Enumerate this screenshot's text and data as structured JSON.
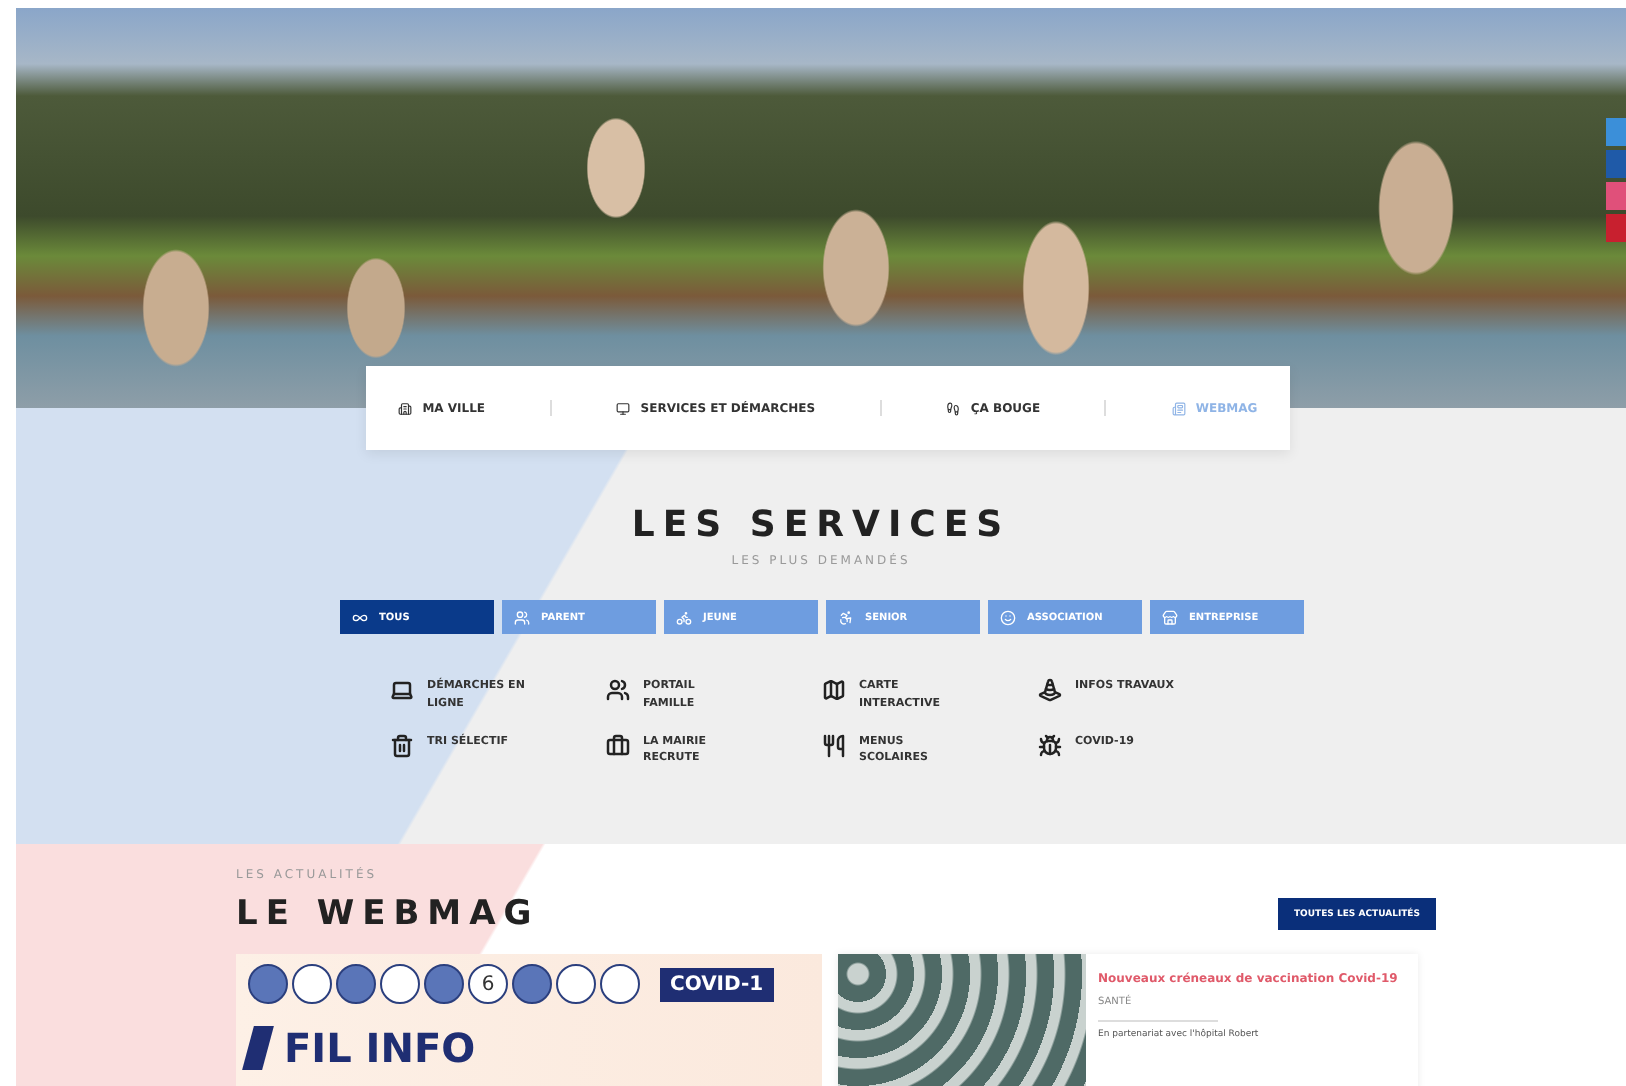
{
  "social_links": [
    {
      "color": "#3b8fd9"
    },
    {
      "color": "#1f5aa8"
    },
    {
      "color": "#e0507a"
    },
    {
      "color": "#c8202f"
    }
  ],
  "main_nav": [
    {
      "label": "MA VILLE",
      "selected": false
    },
    {
      "label": "SERVICES ET DÉMARCHES",
      "selected": false
    },
    {
      "label": "ÇA BOUGE",
      "selected": false
    },
    {
      "label": "WEBMAG",
      "selected": true
    }
  ],
  "services": {
    "title": "LES SERVICES",
    "subtitle": "LES PLUS DEMANDÉS",
    "filters": [
      {
        "label": "TOUS",
        "selected": true
      },
      {
        "label": "PARENT",
        "selected": false
      },
      {
        "label": "JEUNE",
        "selected": false
      },
      {
        "label": "SENIOR",
        "selected": false
      },
      {
        "label": "ASSOCIATION",
        "selected": false
      },
      {
        "label": "ENTREPRISE",
        "selected": false
      }
    ],
    "links": [
      {
        "label": "DÉMARCHES EN LIGNE",
        "kind": "laptop"
      },
      {
        "label": "PORTAIL FAMILLE",
        "kind": "family"
      },
      {
        "label": "CARTE INTERACTIVE",
        "kind": "map"
      },
      {
        "label": "INFOS TRAVAUX",
        "kind": "cone"
      },
      {
        "label": "TRI SÉLECTIF",
        "kind": "bin"
      },
      {
        "label": "LA MAIRIE RECRUTE",
        "kind": "briefcase"
      },
      {
        "label": "MENUS SCOLAIRES",
        "kind": "cutlery"
      },
      {
        "label": "COVID-19",
        "kind": "virus"
      }
    ]
  },
  "webmag": {
    "eyebrow": "LES ACTUALITÉS",
    "title": "LE WEBMAG",
    "all_button": "TOUTES LES ACTUALITÉS",
    "feature": {
      "badge": "COVID-1",
      "number_icon": "6",
      "headline": "FIL INFO"
    },
    "article": {
      "title": "Nouveaux créneaux de vaccination Covid-19",
      "category": "SANTÉ",
      "excerpt": "En partenariat avec l'hôpital Robert"
    }
  }
}
